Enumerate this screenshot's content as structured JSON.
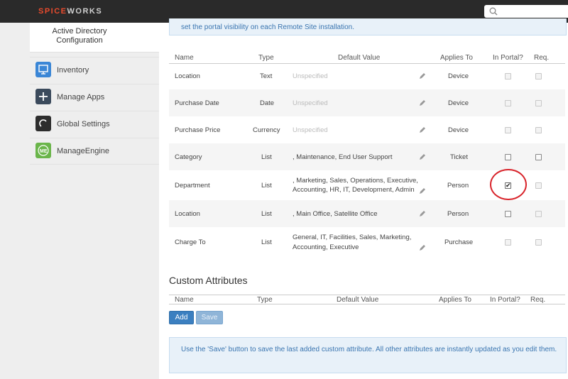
{
  "app": {
    "logo_part1": "SPICE",
    "logo_part2": "WORKS"
  },
  "search": {
    "placeholder": ""
  },
  "sidebar": {
    "header_line1": "Active Directory",
    "header_line2": "Configuration",
    "items": [
      {
        "label": "Inventory",
        "icon": "monitor-icon",
        "color": "#3a86d6"
      },
      {
        "label": "Manage Apps",
        "icon": "plus-icon",
        "color": "#3b4a5c"
      },
      {
        "label": "Global Settings",
        "icon": "spinner-icon",
        "color": "#2d2d2d"
      },
      {
        "label": "ManageEngine",
        "icon": "manageengine-icon",
        "color": "#6ab54a"
      }
    ]
  },
  "main": {
    "info_top": "set the portal visibility on each Remote Site installation.",
    "table": {
      "headers": {
        "name": "Name",
        "type": "Type",
        "default": "Default Value",
        "applies": "Applies To",
        "portal": "In Portal?",
        "req": "Req."
      },
      "rows": [
        {
          "name": "Location",
          "type": "Text",
          "default": "Unspecified",
          "default2": "",
          "muted": true,
          "applies": "Device",
          "portal": false,
          "req": false,
          "dark": false
        },
        {
          "name": "Purchase Date",
          "type": "Date",
          "default": "Unspecified",
          "default2": "",
          "muted": true,
          "applies": "Device",
          "portal": false,
          "req": false,
          "dark": false
        },
        {
          "name": "Purchase Price",
          "type": "Currency",
          "default": "Unspecified",
          "default2": "",
          "muted": true,
          "applies": "Device",
          "portal": false,
          "req": false,
          "dark": false
        },
        {
          "name": "Category",
          "type": "List",
          "default": ", Maintenance, End User Support",
          "default2": "",
          "muted": false,
          "applies": "Ticket",
          "portal": false,
          "req": false,
          "dark": true
        },
        {
          "name": "Department",
          "type": "List",
          "default": ", Marketing, Sales, Operations, Executive,",
          "default2": "Accounting, HR, IT, Development, Admin",
          "muted": false,
          "applies": "Person",
          "portal": true,
          "req": false,
          "dark": false
        },
        {
          "name": "Location",
          "type": "List",
          "default": ", Main Office, Satellite Office",
          "default2": "",
          "muted": false,
          "applies": "Person",
          "portal": false,
          "req": false,
          "dark": true
        },
        {
          "name": "Charge To",
          "type": "List",
          "default": "General, IT, Facilities, Sales, Marketing,",
          "default2": "Accounting, Executive",
          "muted": false,
          "applies": "Purchase",
          "portal": false,
          "req": false,
          "dark": false
        }
      ]
    },
    "custom": {
      "title": "Custom Attributes",
      "headers": {
        "name": "Name",
        "type": "Type",
        "default": "Default Value",
        "applies": "Applies To",
        "portal": "In Portal?",
        "req": "Req."
      },
      "add_label": "Add",
      "save_label": "Save"
    },
    "info_bottom": "Use the 'Save' button to save the last added custom attribute. All other attributes are instantly updated as you edit them."
  }
}
